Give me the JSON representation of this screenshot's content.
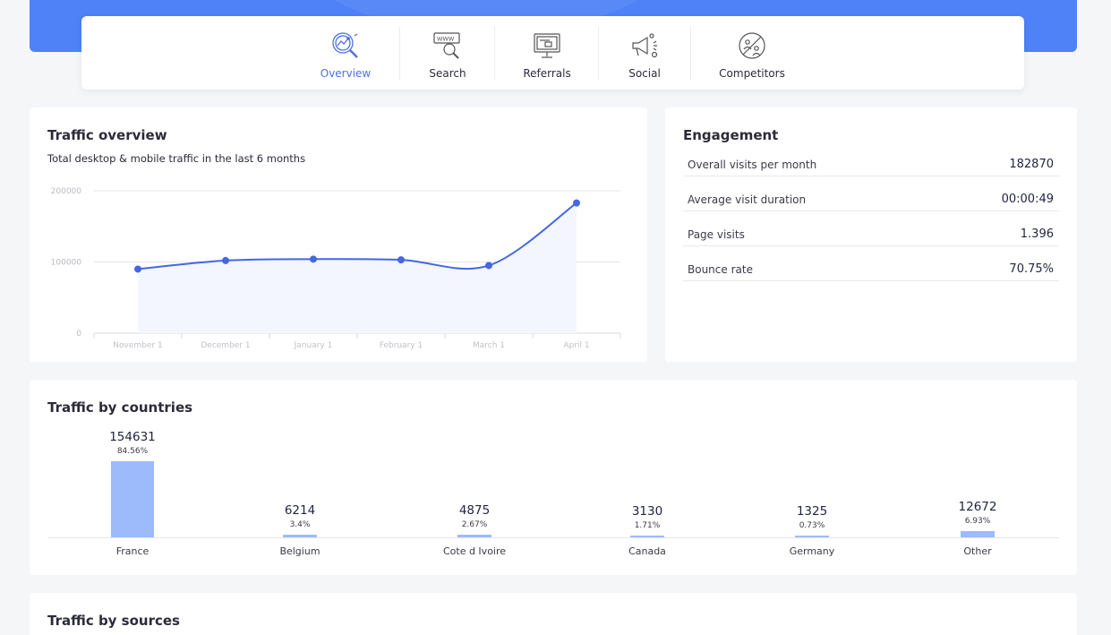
{
  "nav": {
    "tabs": [
      {
        "label": "Overview",
        "icon": "overview-magnifier-chart-icon",
        "active": true
      },
      {
        "label": "Search",
        "icon": "www-search-icon",
        "active": false
      },
      {
        "label": "Referrals",
        "icon": "monitor-link-icon",
        "active": false
      },
      {
        "label": "Social",
        "icon": "megaphone-social-icon",
        "active": false
      },
      {
        "label": "Competitors",
        "icon": "competitors-badge-icon",
        "active": false
      }
    ],
    "accent": "#4f82f7"
  },
  "traffic_overview": {
    "title": "Traffic overview",
    "subtitle": "Total desktop & mobile traffic in the last 6 months"
  },
  "engagement": {
    "title": "Engagement",
    "rows": [
      {
        "label": "Overall visits per month",
        "value": "182870"
      },
      {
        "label": "Average visit duration",
        "value": "00:00:49"
      },
      {
        "label": "Page visits",
        "value": "1.396"
      },
      {
        "label": "Bounce rate",
        "value": "70.75%"
      }
    ]
  },
  "countries": {
    "title": "Traffic by countries",
    "items": [
      {
        "name": "France",
        "value": "154631",
        "pct": "84.56%",
        "share": 84.56
      },
      {
        "name": "Belgium",
        "value": "6214",
        "pct": "3.4%",
        "share": 3.4
      },
      {
        "name": "Cote d Ivoire",
        "value": "4875",
        "pct": "2.67%",
        "share": 2.67
      },
      {
        "name": "Canada",
        "value": "3130",
        "pct": "1.71%",
        "share": 1.71
      },
      {
        "name": "Germany",
        "value": "1325",
        "pct": "0.73%",
        "share": 0.73
      },
      {
        "name": "Other",
        "value": "12672",
        "pct": "6.93%",
        "share": 6.93
      }
    ],
    "bar_color": "#9dbbfb"
  },
  "sources": {
    "title": "Traffic by sources"
  },
  "chart_data": {
    "type": "area",
    "categories": [
      "November 1",
      "December 1",
      "January 1",
      "February 1",
      "March 1",
      "April 1"
    ],
    "series": [
      {
        "values": [
          90000,
          102000,
          104000,
          103000,
          95000,
          182870
        ]
      }
    ],
    "yticks": [
      "0",
      "100000",
      "200000"
    ],
    "ylim": [
      0,
      200000
    ],
    "grid": true,
    "line_color": "#4466e6",
    "fill_color": "#f3f6fe"
  }
}
